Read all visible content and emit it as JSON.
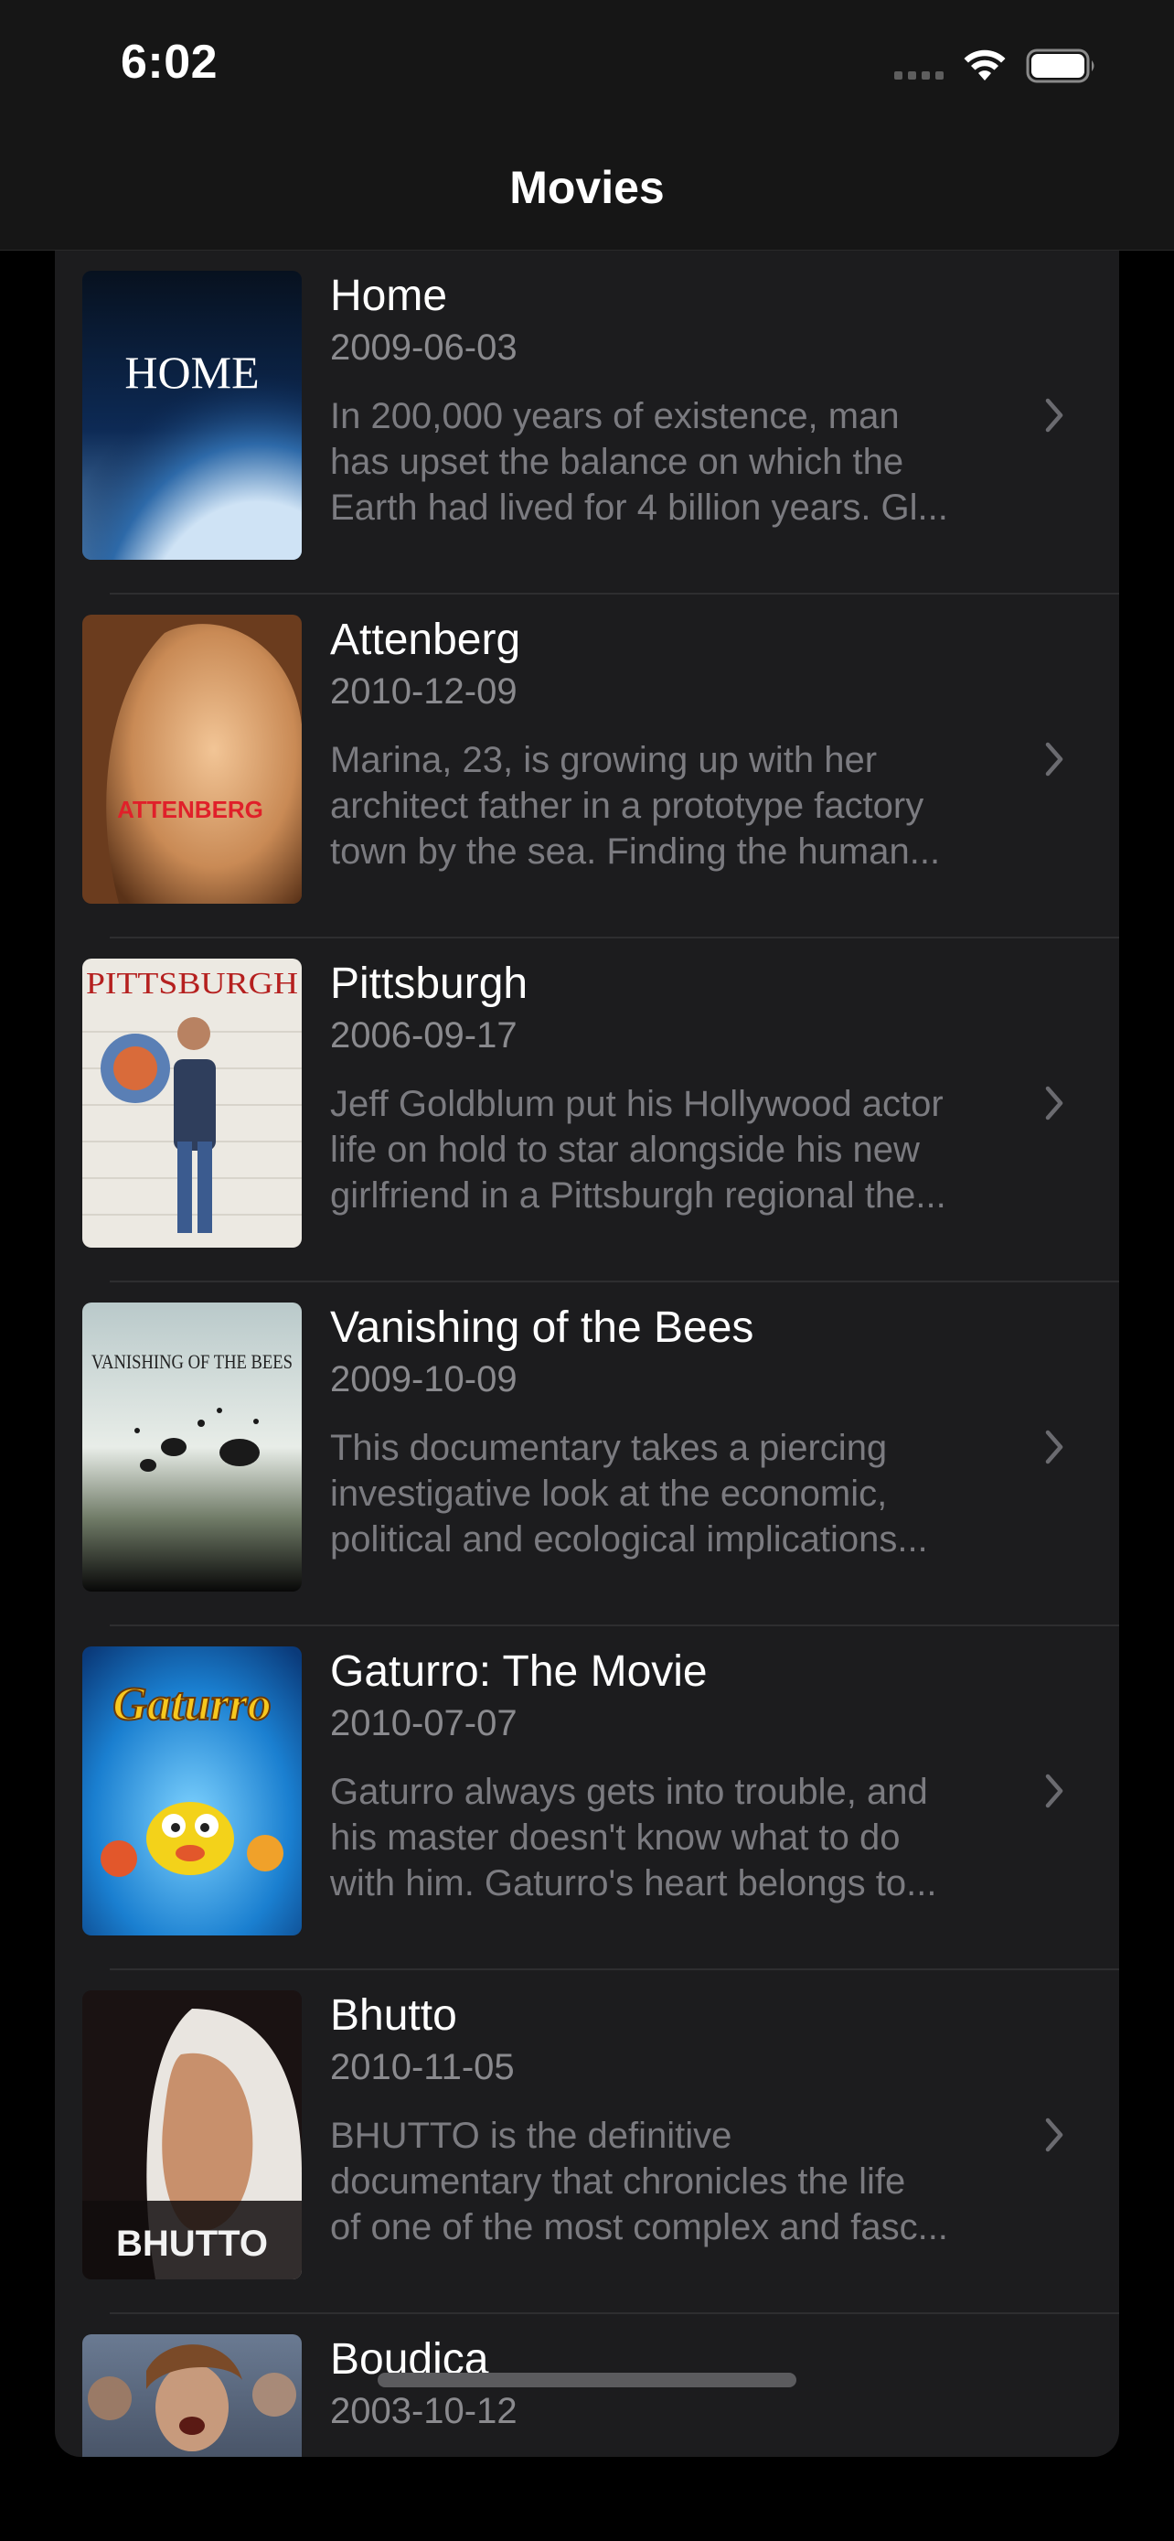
{
  "status_bar": {
    "time": "6:02"
  },
  "nav": {
    "title": "Movies"
  },
  "movies": [
    {
      "title": "Home",
      "date": "2009-06-03",
      "overview": [
        "In 200,000 years of existence, man",
        "has upset the balance on which the",
        "Earth had lived for 4 billion years. Gl..."
      ],
      "poster_text": "HOME"
    },
    {
      "title": "Attenberg",
      "date": "2010-12-09",
      "overview": [
        "Marina, 23, is growing up with her",
        "architect father in a prototype factory",
        "town by the sea. Finding the human..."
      ],
      "poster_text": "ATTENBERG"
    },
    {
      "title": "Pittsburgh",
      "date": "2006-09-17",
      "overview": [
        "Jeff Goldblum put his Hollywood actor",
        "life on hold to star alongside his new",
        "girlfriend in a Pittsburgh regional the..."
      ],
      "poster_text": "PITTSBURGH"
    },
    {
      "title": "Vanishing of the Bees",
      "date": "2009-10-09",
      "overview": [
        "This documentary takes a piercing",
        "investigative look at the economic,",
        "political and ecological implications..."
      ],
      "poster_text": "VANISHING OF THE BEES"
    },
    {
      "title": "Gaturro: The Movie",
      "date": "2010-07-07",
      "overview": [
        "Gaturro always gets into trouble, and",
        "his master doesn't know what to do",
        "with him. Gaturro's heart belongs to..."
      ],
      "poster_text": "Gaturro"
    },
    {
      "title": "Bhutto",
      "date": "2010-11-05",
      "overview": [
        "BHUTTO is the definitive",
        "documentary that chronicles the life",
        "of one of the most complex and fasc..."
      ],
      "poster_text": "BHUTTO"
    },
    {
      "title": "Boudica",
      "date": "2003-10-12",
      "overview": [],
      "poster_text": ""
    }
  ]
}
